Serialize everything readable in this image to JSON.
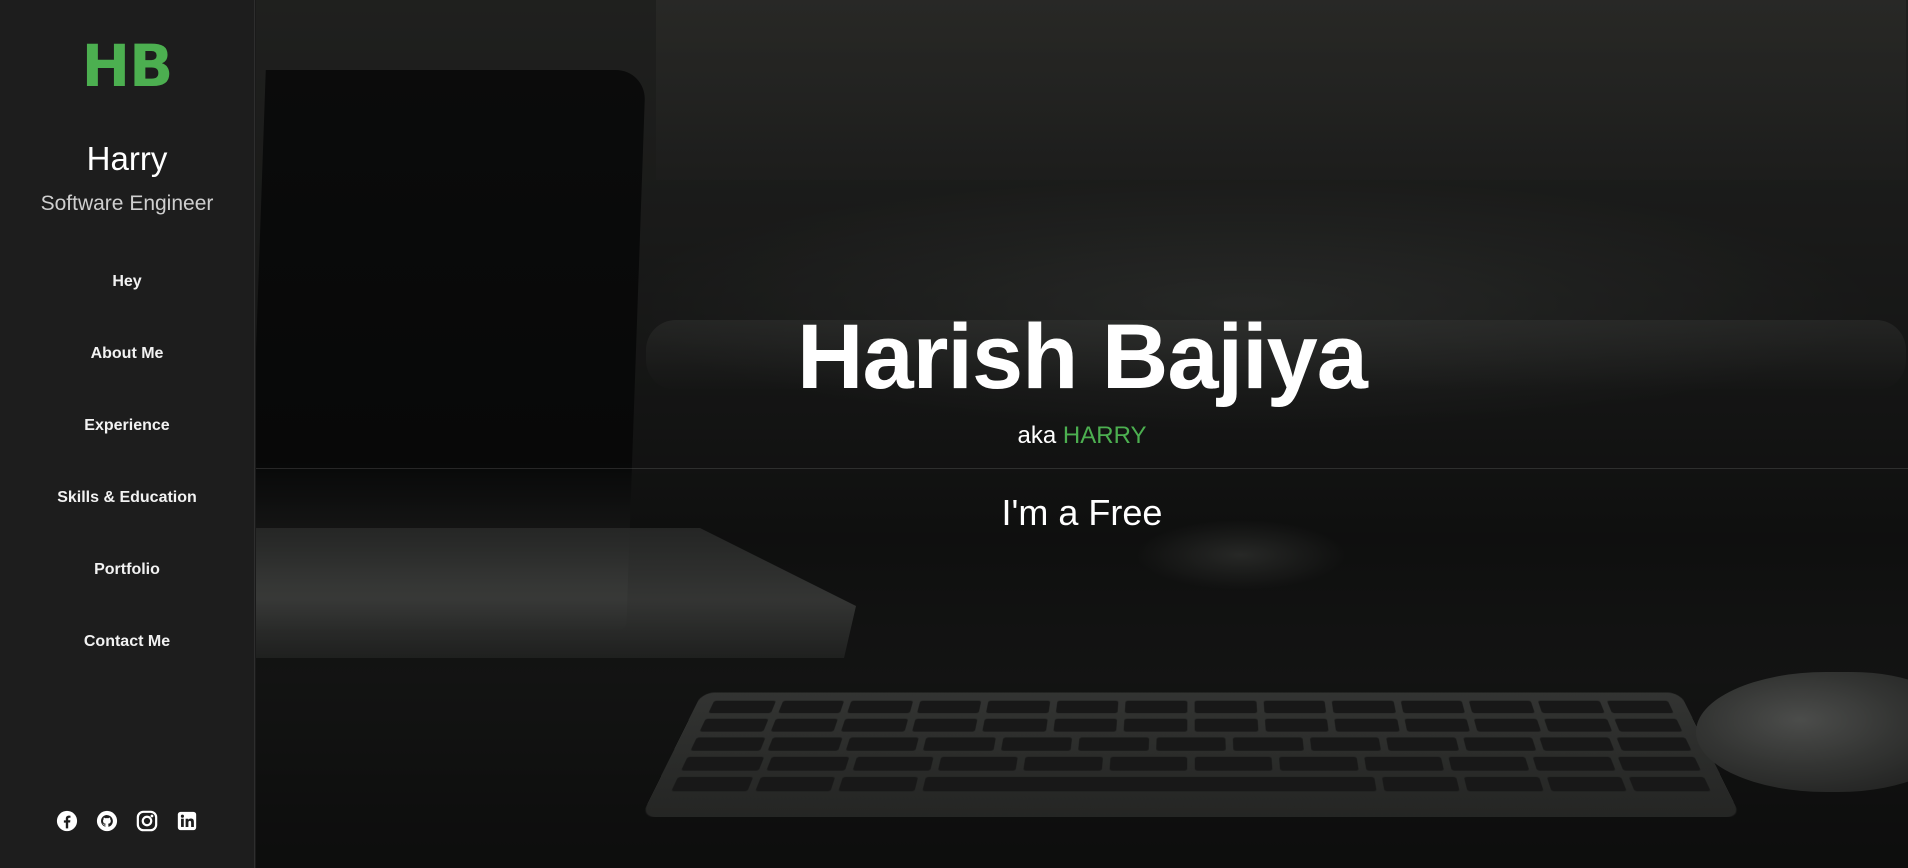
{
  "sidebar": {
    "logo": "HB",
    "name": "Harry",
    "role": "Software Engineer",
    "nav": [
      {
        "label": "Hey"
      },
      {
        "label": "About Me"
      },
      {
        "label": "Experience"
      },
      {
        "label": "Skills & Education"
      },
      {
        "label": "Portfolio"
      },
      {
        "label": "Contact Me"
      }
    ],
    "social": [
      {
        "icon": "facebook-icon"
      },
      {
        "icon": "github-icon"
      },
      {
        "icon": "instagram-icon"
      },
      {
        "icon": "linkedin-icon"
      }
    ]
  },
  "hero": {
    "title": "Harish Bajiya",
    "aka_prefix": "aka",
    "aka_name": "HARRY",
    "typed_text": "I'm a Free"
  },
  "colors": {
    "accent": "#4caf50",
    "sidebar_bg": "#1d1d1d",
    "text": "#ffffff"
  }
}
